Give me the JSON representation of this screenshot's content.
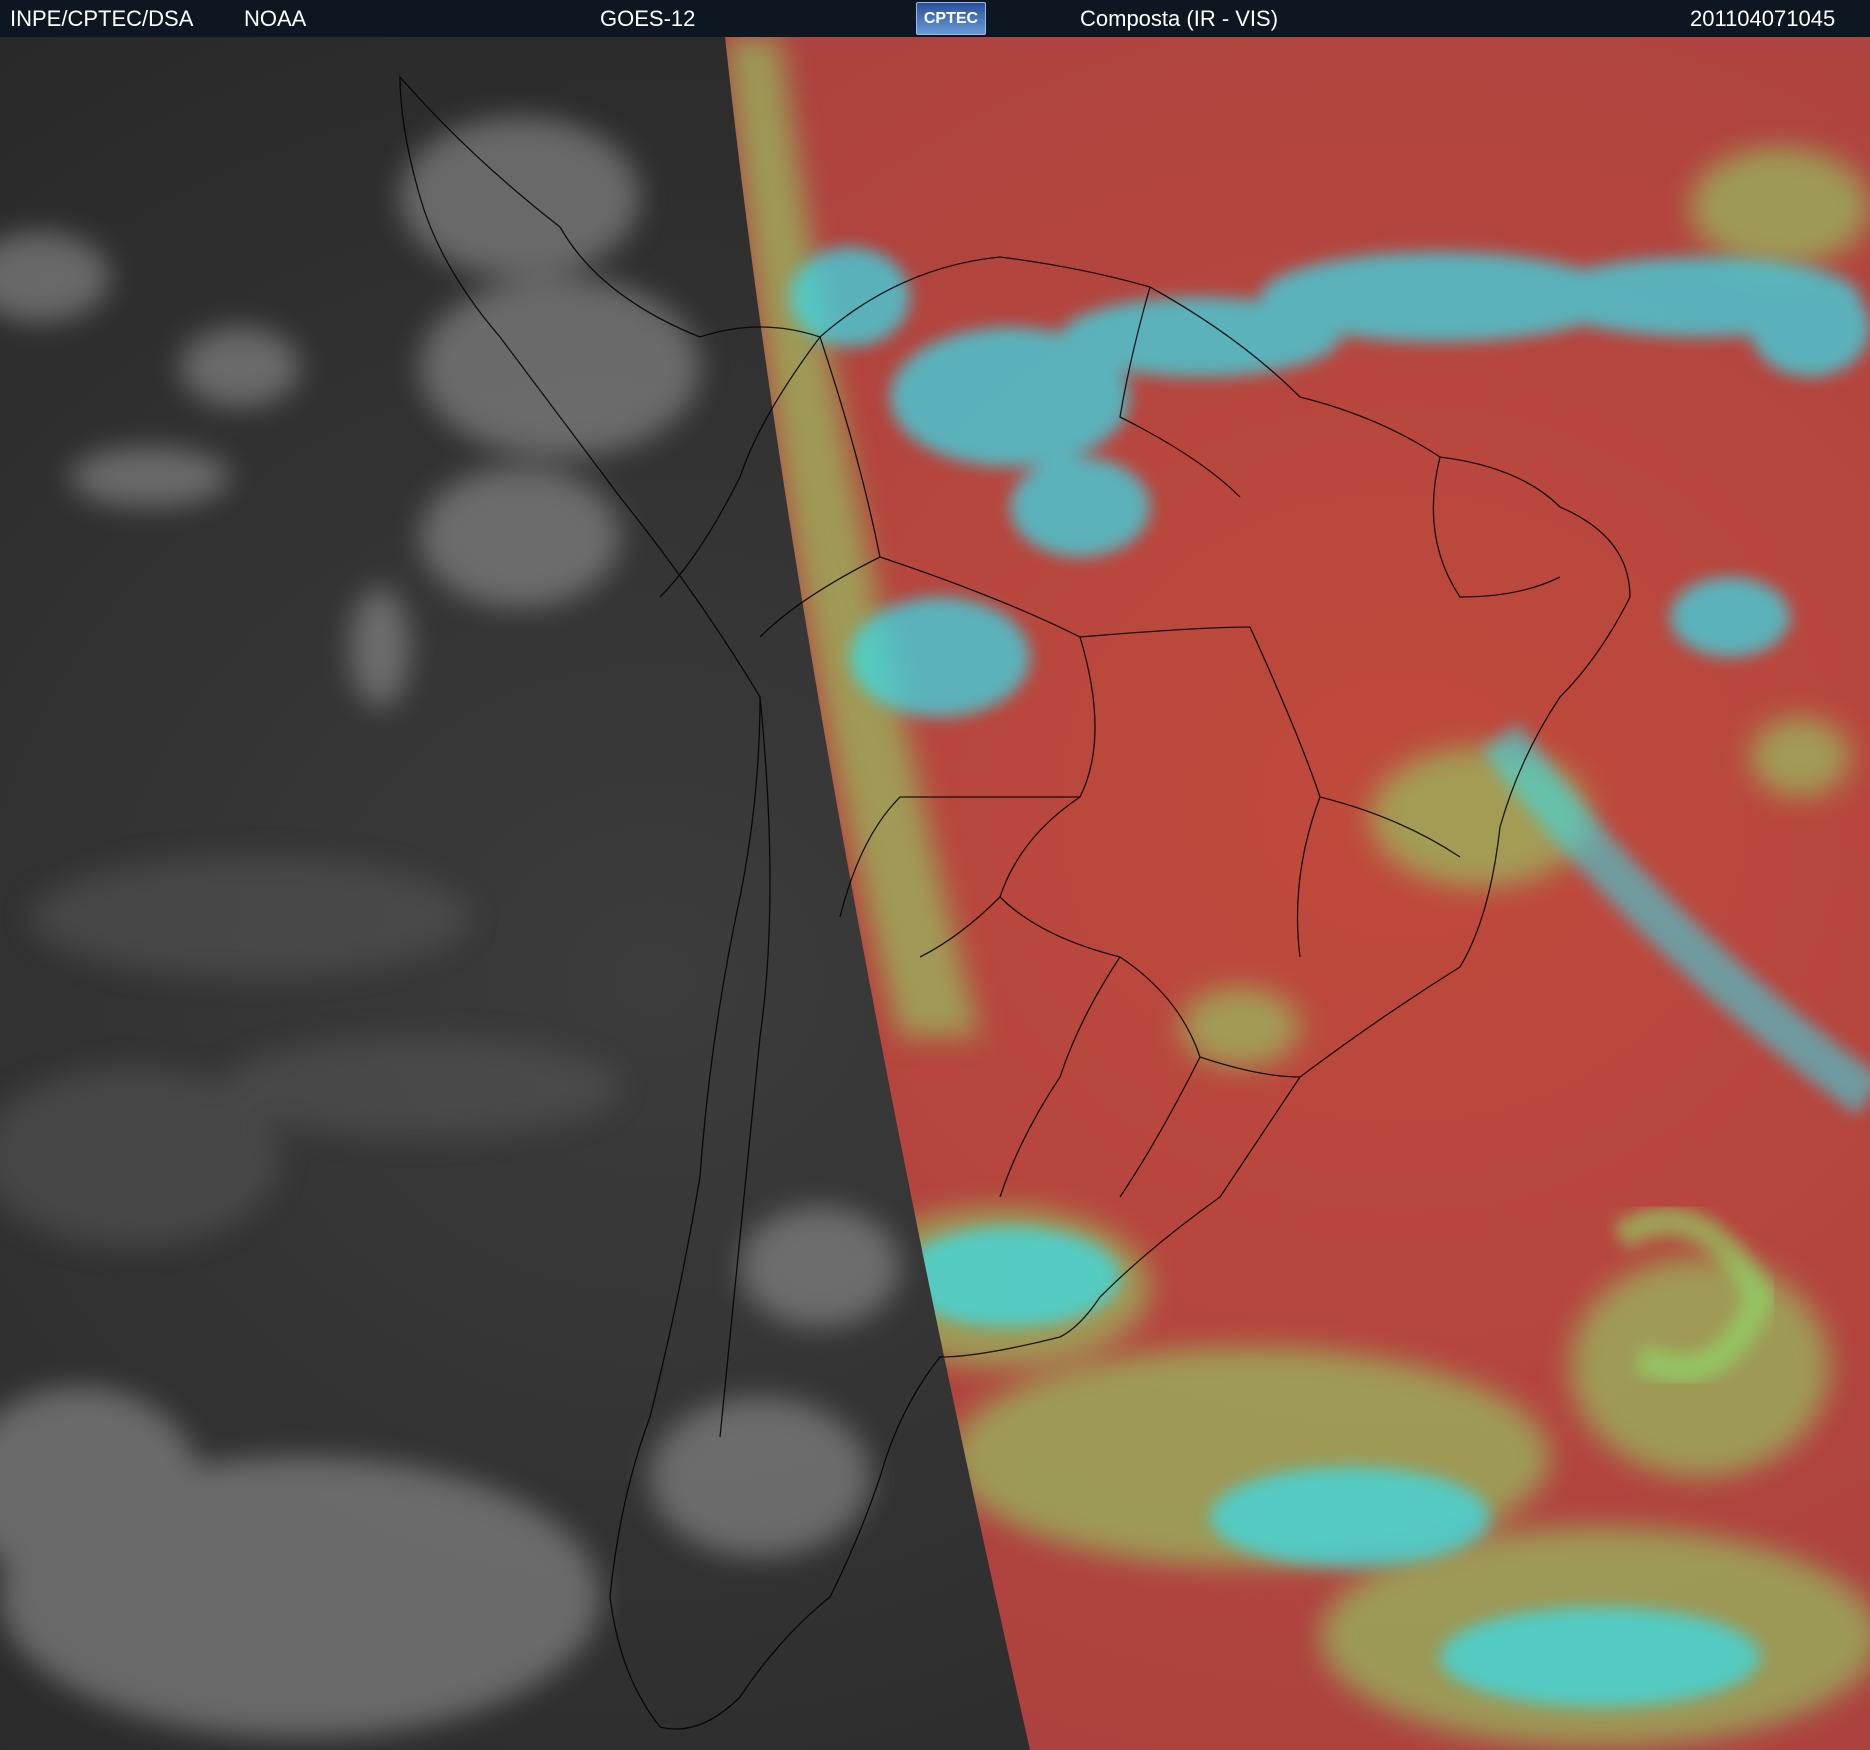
{
  "header": {
    "institution": "INPE/CPTEC/DSA",
    "agency": "NOAA",
    "satellite": "GOES-12",
    "logo_text": "CPTEC",
    "product": "Composta (IR - VIS)",
    "timestamp": "201104071045"
  },
  "colors": {
    "header_bg": "#0d1722",
    "night_side": "#2f2f2f",
    "day_surface": "#b5473d",
    "cloud_low": "#8ee06a",
    "cloud_high": "#35e0f0",
    "border_lines": "#000000"
  }
}
